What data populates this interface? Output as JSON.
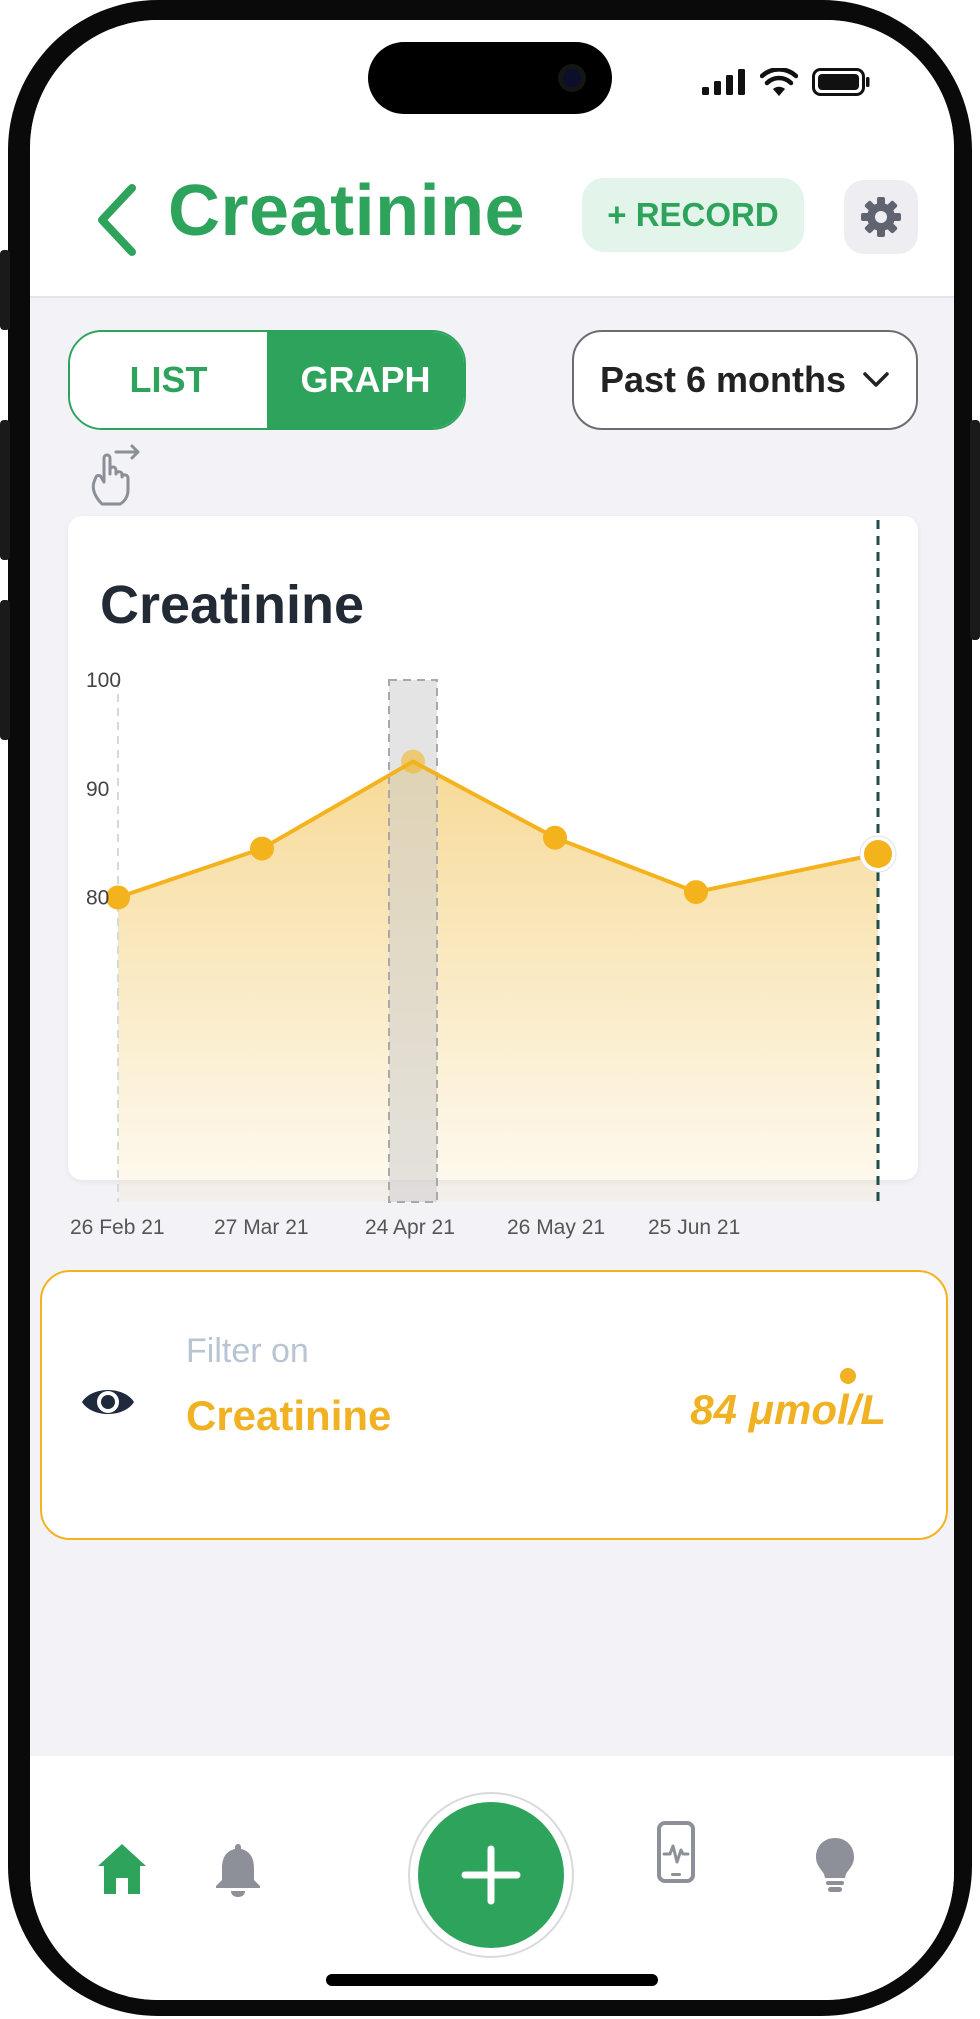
{
  "header": {
    "title": "Creatinine",
    "record_label": "+ RECORD"
  },
  "view_toggle": {
    "list_label": "LIST",
    "graph_label": "GRAPH",
    "active": "GRAPH"
  },
  "period_select": {
    "selected": "Past 6 months"
  },
  "chart_data": {
    "type": "area",
    "title": "Creatinine",
    "x": [
      "26 Feb 21",
      "27 Mar 21",
      "24 Apr 21",
      "26 May 21",
      "25 Jun 21",
      ""
    ],
    "x_tick_labels": [
      "26 Feb 21",
      "27 Mar 21",
      "24 Apr 21",
      "26 May 21",
      "25 Jun 21"
    ],
    "series": [
      {
        "values": [
          80,
          84.5,
          92.5,
          85.5,
          80.5,
          84
        ]
      }
    ],
    "y_ticks": [
      100,
      90,
      80
    ],
    "ylim": [
      52,
      100
    ],
    "highlighted_index": 2,
    "selected_index": 5,
    "colors": {
      "line": "#f4b21c",
      "fill": "#f6d892",
      "marker_line": "#1f4d49"
    }
  },
  "filter_card": {
    "filter_on_label": "Filter on",
    "metric_name": "Creatinine",
    "value_text": "84 μmol/L"
  },
  "bottom_nav": {
    "items": [
      "home-icon",
      "bell-icon",
      "add-icon",
      "device-monitor-icon",
      "lightbulb-icon"
    ],
    "active": "home-icon"
  },
  "colors": {
    "brand_green": "#2ea35c",
    "accent_yellow": "#f0b222",
    "background": "#f3f2f7"
  }
}
